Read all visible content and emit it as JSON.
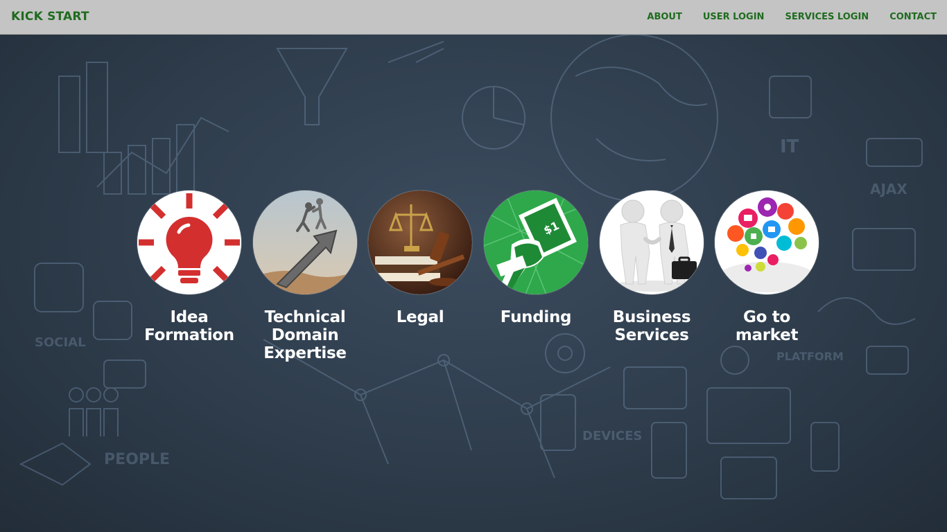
{
  "navbar": {
    "brand": "KICK START",
    "links": [
      {
        "label": "ABOUT"
      },
      {
        "label": "USER LOGIN"
      },
      {
        "label": "SERVICES LOGIN"
      },
      {
        "label": "CONTACT"
      }
    ]
  },
  "background": {
    "doodle_words": [
      "IT",
      "AJAX",
      "SOCIAL",
      "PEOPLE",
      "DEVICES",
      "PLATFORM"
    ]
  },
  "services": [
    {
      "label": "Idea\nFormation",
      "icon": "lightbulb-icon"
    },
    {
      "label": "Technical\nDomain\nExpertise",
      "icon": "climbing-arrow-icon"
    },
    {
      "label": "Legal",
      "icon": "scales-gavel-icon"
    },
    {
      "label": "Funding",
      "icon": "money-fist-icon"
    },
    {
      "label": "Business\nServices",
      "icon": "handshake-icon"
    },
    {
      "label": "Go to\nmarket",
      "icon": "social-bubbles-icon"
    }
  ],
  "colors": {
    "navbar_bg": "#c4c4c4",
    "brand_green": "#1f6b1f",
    "page_bg": "#2c3947",
    "label_text": "#ffffff"
  }
}
